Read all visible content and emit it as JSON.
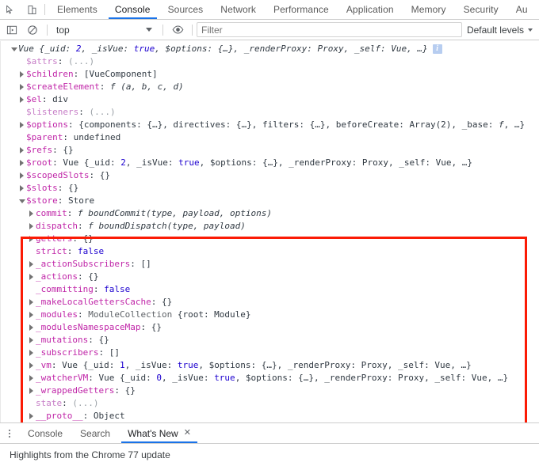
{
  "panel_tabs": {
    "buttons": [
      {
        "name": "inspect-element-icon",
        "title": "Inspect element"
      },
      {
        "name": "device-toolbar-icon",
        "title": "Toggle device toolbar"
      }
    ],
    "items": [
      {
        "label": "Elements",
        "selected": false
      },
      {
        "label": "Console",
        "selected": true
      },
      {
        "label": "Sources",
        "selected": false
      },
      {
        "label": "Network",
        "selected": false
      },
      {
        "label": "Performance",
        "selected": false
      },
      {
        "label": "Application",
        "selected": false
      },
      {
        "label": "Memory",
        "selected": false
      },
      {
        "label": "Security",
        "selected": false
      },
      {
        "label": "Au",
        "selected": false
      }
    ]
  },
  "console_toolbar": {
    "sidebar_toggle_icon": "show-console-sidebar-icon",
    "clear_icon": "clear-console-icon",
    "context_value": "top",
    "eye_icon": "live-expression-eye-icon",
    "filter_placeholder": "Filter",
    "filter_value": "",
    "levels_label": "Default levels"
  },
  "console_lines": [
    {
      "indent": 0,
      "arrow": "down",
      "badge": "i",
      "tokens": [
        {
          "t": "head",
          "v": "Vue {_uid: "
        },
        {
          "t": "num-i",
          "v": "2"
        },
        {
          "t": "head",
          "v": ", _isVue: "
        },
        {
          "t": "kw-i",
          "v": "true"
        },
        {
          "t": "head",
          "v": ", $options: {…}, _renderProxy: Proxy, _self: Vue, …}"
        }
      ]
    },
    {
      "indent": 1,
      "arrow": "none",
      "tokens": [
        {
          "t": "accessor",
          "v": "$attrs"
        },
        {
          "t": "plain",
          "v": ": "
        },
        {
          "t": "dim",
          "v": "(...)"
        }
      ]
    },
    {
      "indent": 1,
      "arrow": "right",
      "tokens": [
        {
          "t": "prop",
          "v": "$children"
        },
        {
          "t": "plain",
          "v": ": [VueComponent]"
        }
      ]
    },
    {
      "indent": 1,
      "arrow": "right",
      "tokens": [
        {
          "t": "prop",
          "v": "$createElement"
        },
        {
          "t": "plain",
          "v": ": "
        },
        {
          "t": "fn-italic",
          "v": "f (a, b, c, d)"
        }
      ]
    },
    {
      "indent": 1,
      "arrow": "right",
      "tokens": [
        {
          "t": "prop",
          "v": "$el"
        },
        {
          "t": "plain",
          "v": ": div"
        }
      ]
    },
    {
      "indent": 1,
      "arrow": "none",
      "tokens": [
        {
          "t": "accessor",
          "v": "$listeners"
        },
        {
          "t": "plain",
          "v": ": "
        },
        {
          "t": "dim",
          "v": "(...)"
        }
      ]
    },
    {
      "indent": 1,
      "arrow": "right",
      "tokens": [
        {
          "t": "prop",
          "v": "$options"
        },
        {
          "t": "plain",
          "v": ": {components: {…}, directives: {…}, filters: {…}, beforeCreate: Array(2), _base: "
        },
        {
          "t": "fn-italic",
          "v": "f"
        },
        {
          "t": "plain",
          "v": ", …}"
        }
      ]
    },
    {
      "indent": 1,
      "arrow": "none",
      "tokens": [
        {
          "t": "prop",
          "v": "$parent"
        },
        {
          "t": "plain",
          "v": ": undefined"
        }
      ]
    },
    {
      "indent": 1,
      "arrow": "right",
      "tokens": [
        {
          "t": "prop",
          "v": "$refs"
        },
        {
          "t": "plain",
          "v": ": {}"
        }
      ]
    },
    {
      "indent": 1,
      "arrow": "right",
      "tokens": [
        {
          "t": "prop",
          "v": "$root"
        },
        {
          "t": "plain",
          "v": ": Vue {_uid: "
        },
        {
          "t": "num",
          "v": "2"
        },
        {
          "t": "plain",
          "v": ", _isVue: "
        },
        {
          "t": "kw",
          "v": "true"
        },
        {
          "t": "plain",
          "v": ", $options: {…}, _renderProxy: Proxy, _self: Vue, …}"
        }
      ]
    },
    {
      "indent": 1,
      "arrow": "right",
      "tokens": [
        {
          "t": "prop",
          "v": "$scopedSlots"
        },
        {
          "t": "plain",
          "v": ": {}"
        }
      ]
    },
    {
      "indent": 1,
      "arrow": "right",
      "tokens": [
        {
          "t": "prop",
          "v": "$slots"
        },
        {
          "t": "plain",
          "v": ": {}"
        }
      ]
    },
    {
      "indent": 1,
      "arrow": "down",
      "tokens": [
        {
          "t": "prop",
          "v": "$store"
        },
        {
          "t": "plain",
          "v": ": Store"
        }
      ]
    },
    {
      "indent": 2,
      "arrow": "right",
      "tokens": [
        {
          "t": "prop",
          "v": "commit"
        },
        {
          "t": "plain",
          "v": ": "
        },
        {
          "t": "fn-italic",
          "v": "f boundCommit(type, payload, options)"
        }
      ]
    },
    {
      "indent": 2,
      "arrow": "right",
      "tokens": [
        {
          "t": "prop",
          "v": "dispatch"
        },
        {
          "t": "plain",
          "v": ": "
        },
        {
          "t": "fn-italic",
          "v": "f boundDispatch(type, payload)"
        }
      ]
    },
    {
      "indent": 2,
      "arrow": "right",
      "tokens": [
        {
          "t": "prop",
          "v": "getters"
        },
        {
          "t": "plain",
          "v": ": {}"
        }
      ]
    },
    {
      "indent": 2,
      "arrow": "none",
      "tokens": [
        {
          "t": "prop",
          "v": "strict"
        },
        {
          "t": "plain",
          "v": ": "
        },
        {
          "t": "kw",
          "v": "false"
        }
      ]
    },
    {
      "indent": 2,
      "arrow": "right",
      "tokens": [
        {
          "t": "prop",
          "v": "_actionSubscribers"
        },
        {
          "t": "plain",
          "v": ": []"
        }
      ]
    },
    {
      "indent": 2,
      "arrow": "right",
      "tokens": [
        {
          "t": "prop",
          "v": "_actions"
        },
        {
          "t": "plain",
          "v": ": {}"
        }
      ]
    },
    {
      "indent": 2,
      "arrow": "none",
      "tokens": [
        {
          "t": "prop",
          "v": "_committing"
        },
        {
          "t": "plain",
          "v": ": "
        },
        {
          "t": "kw",
          "v": "false"
        }
      ]
    },
    {
      "indent": 2,
      "arrow": "right",
      "tokens": [
        {
          "t": "prop",
          "v": "_makeLocalGettersCache"
        },
        {
          "t": "plain",
          "v": ": {}"
        }
      ]
    },
    {
      "indent": 2,
      "arrow": "right",
      "tokens": [
        {
          "t": "prop",
          "v": "_modules"
        },
        {
          "t": "plain",
          "v": ": "
        },
        {
          "t": "obj",
          "v": "ModuleCollection"
        },
        {
          "t": "plain",
          "v": " {root: Module}"
        }
      ]
    },
    {
      "indent": 2,
      "arrow": "right",
      "tokens": [
        {
          "t": "prop",
          "v": "_modulesNamespaceMap"
        },
        {
          "t": "plain",
          "v": ": {}"
        }
      ]
    },
    {
      "indent": 2,
      "arrow": "right",
      "tokens": [
        {
          "t": "prop",
          "v": "_mutations"
        },
        {
          "t": "plain",
          "v": ": {}"
        }
      ]
    },
    {
      "indent": 2,
      "arrow": "right",
      "tokens": [
        {
          "t": "prop",
          "v": "_subscribers"
        },
        {
          "t": "plain",
          "v": ": []"
        }
      ]
    },
    {
      "indent": 2,
      "arrow": "right",
      "tokens": [
        {
          "t": "prop",
          "v": "_vm"
        },
        {
          "t": "plain",
          "v": ": Vue {_uid: "
        },
        {
          "t": "num",
          "v": "1"
        },
        {
          "t": "plain",
          "v": ", _isVue: "
        },
        {
          "t": "kw",
          "v": "true"
        },
        {
          "t": "plain",
          "v": ", $options: {…}, _renderProxy: Proxy, _self: Vue, …}"
        }
      ]
    },
    {
      "indent": 2,
      "arrow": "right",
      "tokens": [
        {
          "t": "prop",
          "v": "_watcherVM"
        },
        {
          "t": "plain",
          "v": ": Vue {_uid: "
        },
        {
          "t": "num",
          "v": "0"
        },
        {
          "t": "plain",
          "v": ", _isVue: "
        },
        {
          "t": "kw",
          "v": "true"
        },
        {
          "t": "plain",
          "v": ", $options: {…}, _renderProxy: Proxy, _self: Vue, …}"
        }
      ]
    },
    {
      "indent": 2,
      "arrow": "right",
      "tokens": [
        {
          "t": "prop",
          "v": "_wrappedGetters"
        },
        {
          "t": "plain",
          "v": ": {}"
        }
      ]
    },
    {
      "indent": 2,
      "arrow": "none",
      "tokens": [
        {
          "t": "accessor",
          "v": "state"
        },
        {
          "t": "plain",
          "v": ": "
        },
        {
          "t": "dim",
          "v": "(...)"
        }
      ]
    },
    {
      "indent": 2,
      "arrow": "right",
      "tokens": [
        {
          "t": "prop",
          "v": "__proto__"
        },
        {
          "t": "plain",
          "v": ": Object"
        }
      ]
    }
  ],
  "annotation": {
    "name": "red-highlight-rectangle",
    "color": "#fb1b05"
  },
  "drawer": {
    "menu_icon": "more-options-icon",
    "tabs": [
      {
        "label": "Console",
        "selected": false,
        "closable": false
      },
      {
        "label": "Search",
        "selected": false,
        "closable": false
      },
      {
        "label": "What's New",
        "selected": true,
        "closable": true
      }
    ],
    "close_glyph": "✕",
    "content_text": "Highlights from the Chrome 77 update"
  }
}
